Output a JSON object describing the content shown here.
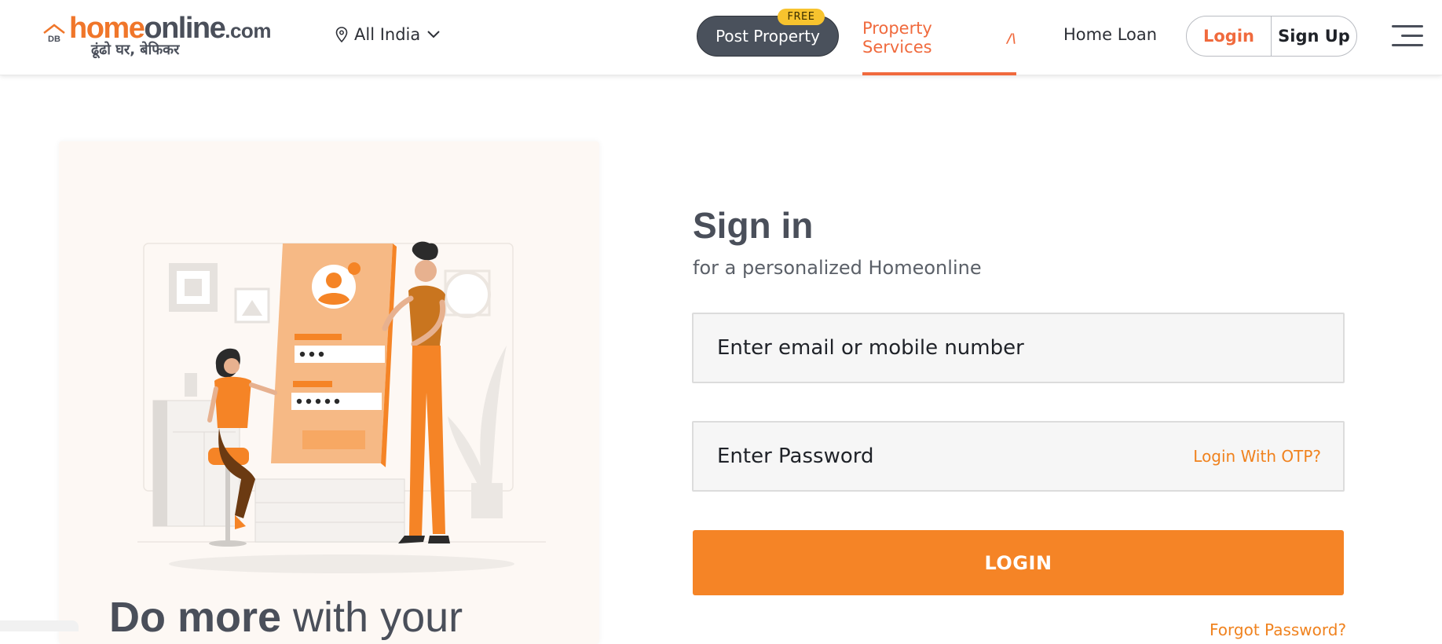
{
  "header": {
    "logo": {
      "badge": "DB",
      "brand_part1": "home",
      "brand_part2": "online",
      "brand_part3": ".com",
      "tagline": "ढूंढो घर, बेफिकर"
    },
    "location": {
      "label": "All India",
      "pin_icon": "location-pin-icon",
      "chevron_icon": "chevron-down-icon"
    },
    "post_property": {
      "label": "Post Property",
      "badge": "FREE"
    },
    "nav": {
      "property_services": {
        "label": "Property Services",
        "icon_glyph": "/\\"
      },
      "home_loan": {
        "label": "Home Loan"
      }
    },
    "auth": {
      "login_label": "Login",
      "signup_label": "Sign Up"
    },
    "menu_icon": "hamburger-icon"
  },
  "promo": {
    "strong": "Do more",
    "rest": " with your"
  },
  "signin": {
    "title": "Sign in",
    "subtitle": "for a personalized Homeonline",
    "email_placeholder": "Enter email or mobile number",
    "password_placeholder": "Enter Password",
    "otp_link": "Login With OTP?",
    "login_button": "LOGIN",
    "forgot_link": "Forgot Password?"
  },
  "colors": {
    "accent": "#f58426",
    "nav_active": "#f06a3d",
    "dark_button": "#4a515c",
    "free_badge": "#f7c32e"
  }
}
